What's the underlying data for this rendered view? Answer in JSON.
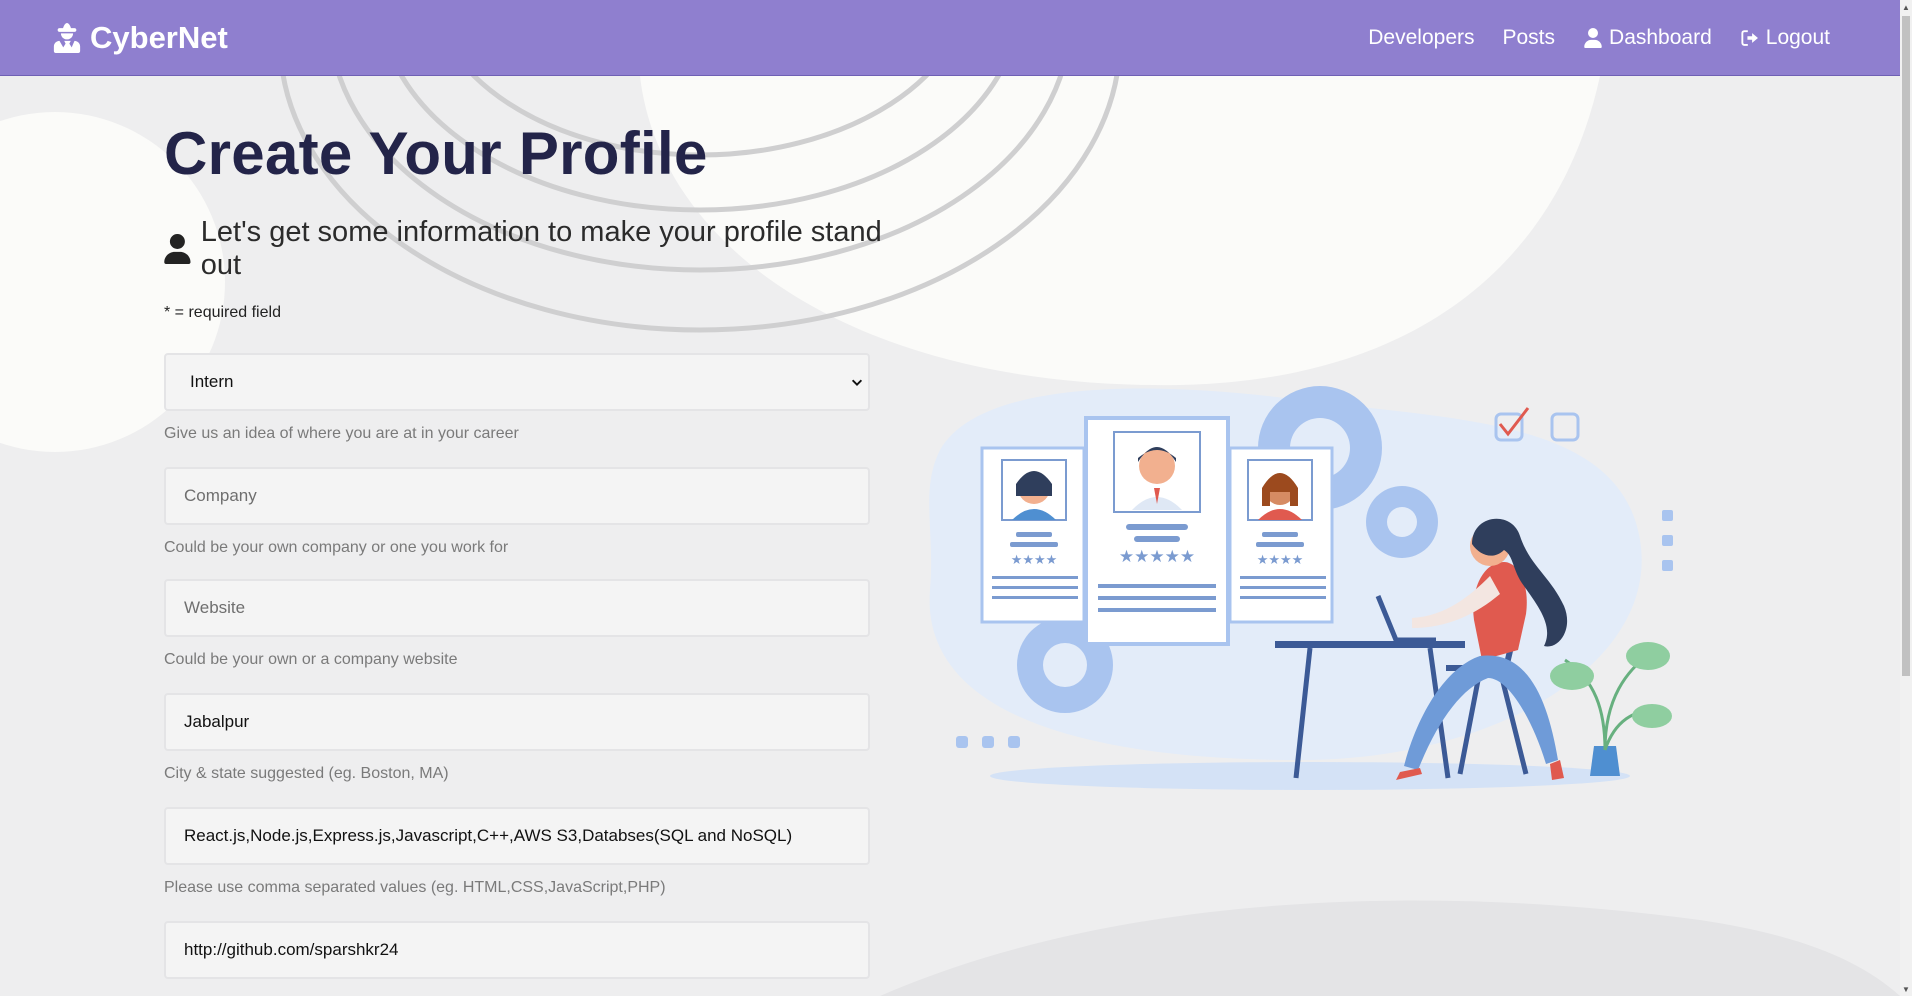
{
  "nav": {
    "brand": "CyberNet",
    "links": [
      "Developers",
      "Posts",
      "Dashboard",
      "Logout"
    ]
  },
  "page": {
    "title": "Create Your Profile",
    "lead": "Let's get some information to make your profile stand out",
    "required_note": "* = required field"
  },
  "form": {
    "status": {
      "value": "Intern",
      "help": "Give us an idea of where you are at in your career"
    },
    "company": {
      "placeholder": "Company",
      "help": "Could be your own company or one you work for"
    },
    "website": {
      "placeholder": "Website",
      "help": "Could be your own or a company website"
    },
    "location": {
      "value": "Jabalpur",
      "help": "City & state suggested (eg. Boston, MA)"
    },
    "skills": {
      "value": "React.js,Node.js,Express.js,Javascript,C++,AWS S3,Databses(SQL and NoSQL)",
      "help": "Please use comma separated values (eg. HTML,CSS,JavaScript,PHP)"
    },
    "github": {
      "value": "http://github.com/sparshkr24"
    }
  },
  "colors": {
    "navbar": "#8f7fcf",
    "title": "#232449"
  }
}
